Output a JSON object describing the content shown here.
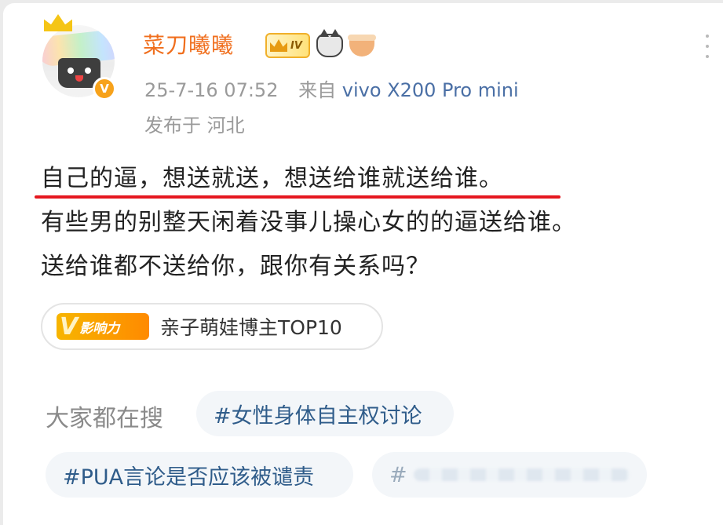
{
  "post": {
    "username": "菜刀曦曦",
    "vip_badge": "IV",
    "verified_mark": "V",
    "timestamp": "25-7-16 07:52",
    "source_prefix": "来自",
    "device": "vivo X200 Pro mini",
    "location": "发布于 河北",
    "lines": [
      "自己的逼，想送就送，想送给谁就送给谁。",
      "有些男的别整天闲着没事儿操心女的的逼送给谁。",
      "送给谁都不送给你，跟你有关系吗？"
    ],
    "influence_badge_v": "V",
    "influence_badge_text": "影响力",
    "influence_text": "亲子萌娃博主TOP10"
  },
  "search": {
    "label": "大家都在搜",
    "tags": [
      "#女性身体自主权讨论",
      "#PUA言论是否应该被谴责",
      "#"
    ]
  },
  "icons": {
    "avatar": "cartoon-avatar",
    "verified": "verified-v-icon",
    "crown": "crown-icon",
    "cat": "cat-face-icon",
    "bowl": "noodle-bowl-icon",
    "more": "more-vertical-icon"
  },
  "colors": {
    "username": "#f06f1e",
    "device_link": "#4a6fa5",
    "underline": "#e5171f",
    "tag_text": "#2f5c8a",
    "influence_badge": "#f7b500"
  }
}
